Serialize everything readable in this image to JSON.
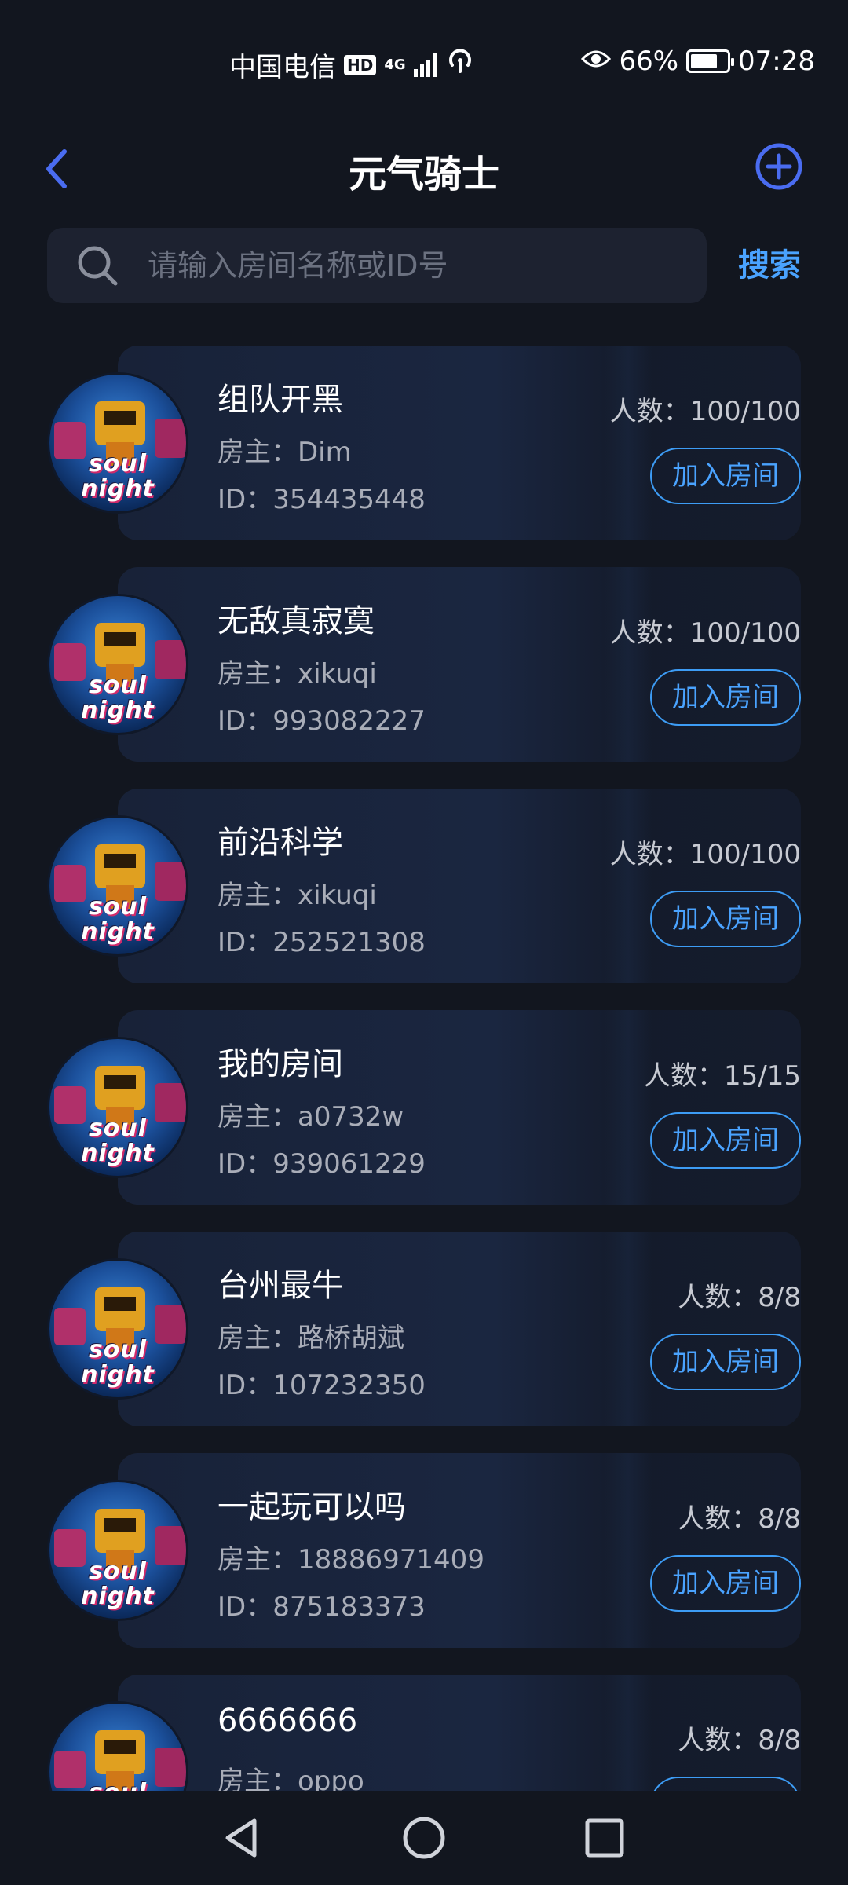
{
  "status_bar": {
    "carrier": "中国电信",
    "hd": "HD",
    "network": "4G",
    "eye_percent": "66%",
    "time": "07:28"
  },
  "header": {
    "title": "元气骑士"
  },
  "search": {
    "placeholder": "请输入房间名称或ID号",
    "button_label": "搜索"
  },
  "rooms": [
    {
      "name": "组队开黑",
      "owner": "房主：Dim",
      "id": "ID：354435448",
      "count": "人数：100/100",
      "join_label": "加入房间",
      "avatar_text": "soul\nnight"
    },
    {
      "name": "无敌真寂寞",
      "owner": "房主：xikuqi",
      "id": "ID：993082227",
      "count": "人数：100/100",
      "join_label": "加入房间",
      "avatar_text": "soul\nnight"
    },
    {
      "name": "前沿科学",
      "owner": "房主：xikuqi",
      "id": "ID：252521308",
      "count": "人数：100/100",
      "join_label": "加入房间",
      "avatar_text": "soul\nnight"
    },
    {
      "name": "我的房间",
      "owner": "房主：a0732w",
      "id": "ID：939061229",
      "count": "人数：15/15",
      "join_label": "加入房间",
      "avatar_text": "soul\nnight"
    },
    {
      "name": "台州最牛",
      "owner": "房主：路桥胡斌",
      "id": "ID：107232350",
      "count": "人数：8/8",
      "join_label": "加入房间",
      "avatar_text": "soul\nnight"
    },
    {
      "name": "一起玩可以吗",
      "owner": "房主：18886971409",
      "id": "ID：875183373",
      "count": "人数：8/8",
      "join_label": "加入房间",
      "avatar_text": "soul\nnight"
    },
    {
      "name": "6666666",
      "owner": "房主：oppo",
      "id": "",
      "count": "人数：8/8",
      "join_label": "加入房间",
      "avatar_text": "soul\nnight"
    }
  ],
  "colors": {
    "accent": "#4aa3ff",
    "background": "#12161f",
    "card": "#1a2640"
  },
  "icons": {
    "back": "back-icon",
    "add": "plus-circle-icon",
    "search": "search-icon"
  }
}
